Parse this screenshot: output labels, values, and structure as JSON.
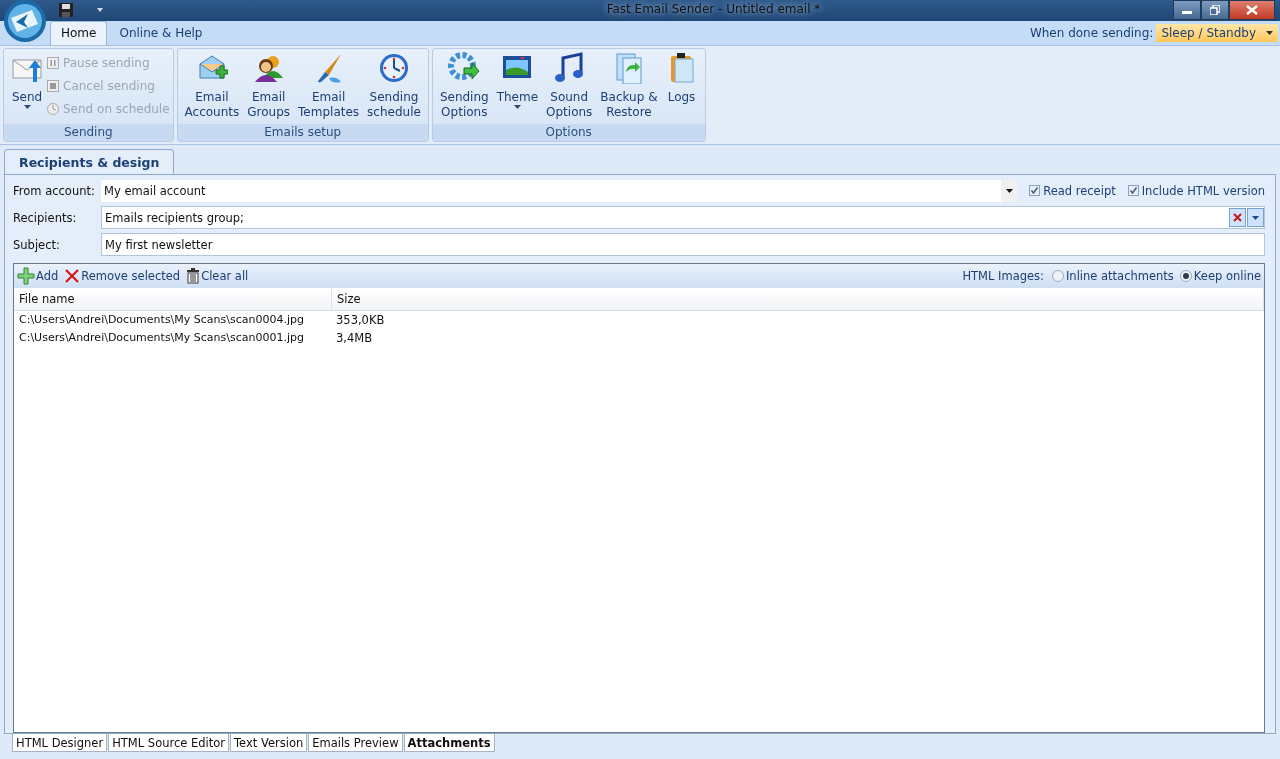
{
  "window": {
    "title": "Fast Email Sender - Untitled email *"
  },
  "ribbon_tabs": [
    {
      "label": "Home",
      "selected": true
    },
    {
      "label": "Online & Help",
      "selected": false
    }
  ],
  "when_done": {
    "label": "When done sending:",
    "value": "Sleep / Standby"
  },
  "ribbon_groups": [
    {
      "title": "Sending",
      "large": [
        {
          "lines": [
            "Send"
          ],
          "dropdown": true
        }
      ],
      "small": [
        {
          "label": "Pause sending",
          "disabled": true
        },
        {
          "label": "Cancel sending",
          "disabled": true
        },
        {
          "label": "Send on schedule",
          "disabled": true
        }
      ]
    },
    {
      "title": "Emails setup",
      "large": [
        {
          "lines": [
            "Email",
            "Accounts"
          ],
          "dropdown": false
        },
        {
          "lines": [
            "Email",
            "Groups"
          ],
          "dropdown": false
        },
        {
          "lines": [
            "Email",
            "Templates"
          ],
          "dropdown": false
        },
        {
          "lines": [
            "Sending",
            "schedule"
          ],
          "dropdown": false
        }
      ]
    },
    {
      "title": "Options",
      "large": [
        {
          "lines": [
            "Sending",
            "Options"
          ],
          "dropdown": false
        },
        {
          "lines": [
            "Theme"
          ],
          "dropdown": true
        },
        {
          "lines": [
            "Sound",
            "Options"
          ],
          "dropdown": false
        },
        {
          "lines": [
            "Backup &",
            "Restore"
          ],
          "dropdown": false
        },
        {
          "lines": [
            "Logs"
          ],
          "dropdown": false
        }
      ]
    }
  ],
  "document_tab": {
    "label": "Recipients & design",
    "selected": true
  },
  "form": {
    "from_account": {
      "label": "From account:",
      "value": "My email account"
    },
    "options": [
      {
        "label": "Read receipt",
        "checked": true
      },
      {
        "label": "Include HTML version",
        "checked": true
      }
    ],
    "recipients": {
      "label": "Recipients:",
      "value": "Emails recipients group;"
    },
    "subject": {
      "label": "Subject:",
      "value": "My first newsletter"
    }
  },
  "attachments": {
    "toolbar": [
      {
        "label": "Add"
      },
      {
        "label": "Remove selected"
      },
      {
        "label": "Clear all"
      }
    ],
    "html_images": {
      "label": "HTML Images:",
      "options": [
        {
          "label": "Inline attachments",
          "selected": false
        },
        {
          "label": "Keep online",
          "selected": true
        }
      ]
    },
    "columns": [
      "File name",
      "Size"
    ],
    "rows": [
      [
        "C:\\Users\\Andrei\\Documents\\My Scans\\scan0004.jpg",
        "353,0KB"
      ],
      [
        "C:\\Users\\Andrei\\Documents\\My Scans\\scan0001.jpg",
        "3,4MB"
      ]
    ]
  },
  "bottom_tabs": [
    {
      "label": "HTML Designer",
      "selected": false
    },
    {
      "label": "HTML Source Editor",
      "selected": false
    },
    {
      "label": "Text Version",
      "selected": false
    },
    {
      "label": "Emails Preview",
      "selected": false
    },
    {
      "label": "Attachments",
      "selected": true
    }
  ]
}
